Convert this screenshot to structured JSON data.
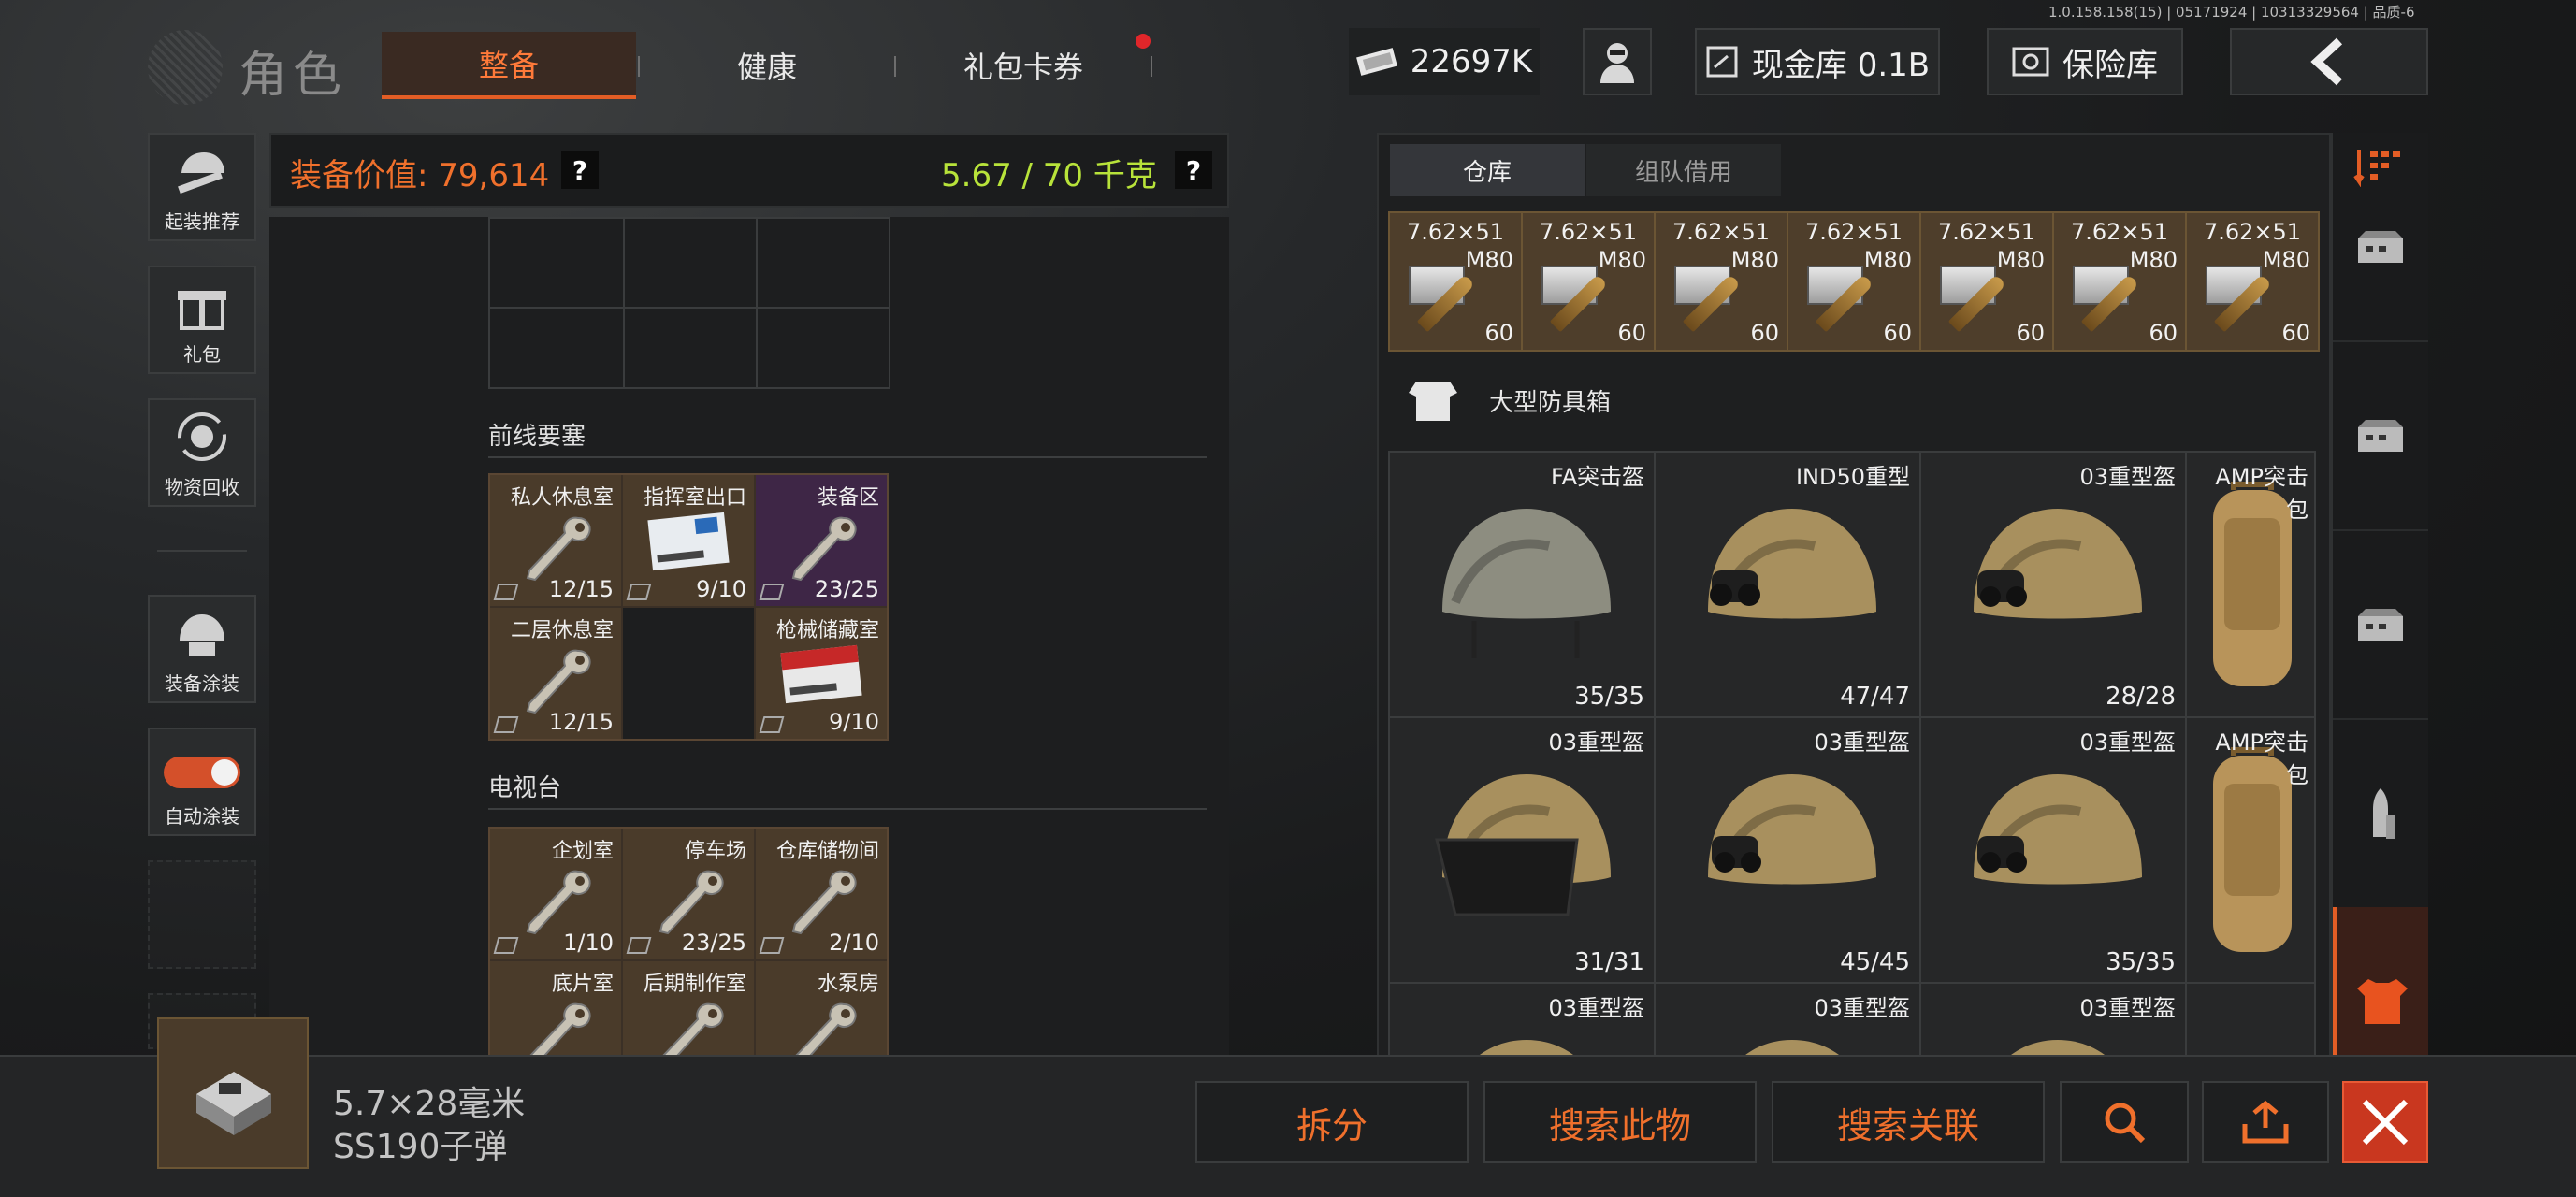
{
  "version": "1.0.158.158(15) | 05171924 | 10313329564 | 品质-6",
  "header": {
    "title": "角色",
    "tabs": [
      {
        "label": "整备",
        "active": true
      },
      {
        "label": "健康",
        "active": false
      },
      {
        "label": "礼包卡券",
        "active": false
      }
    ],
    "currency": "22697K",
    "cash_vault": "现金库 0.1B",
    "insurance": "保险库"
  },
  "sidebar": {
    "items": [
      {
        "label": "起装推荐"
      },
      {
        "label": "礼包"
      },
      {
        "label": "物资回收"
      },
      {
        "label": "装备涂装"
      },
      {
        "label": "自动涂装"
      }
    ]
  },
  "equipment": {
    "value_label": "装备价值: 79,614",
    "weight_label": "5.67 / 70 千克",
    "help": "?",
    "sections": [
      {
        "title": "前线要塞",
        "keys": [
          {
            "name": "私人休息室",
            "count": "12/15",
            "style": "key"
          },
          {
            "name": "指挥室出口",
            "count": "9/10",
            "style": "card"
          },
          {
            "name": "装备区",
            "count": "23/25",
            "style": "purple"
          },
          {
            "name": "二层休息室",
            "count": "12/15",
            "style": "key"
          },
          {
            "name": "",
            "count": "",
            "style": "empty"
          },
          {
            "name": "枪械储藏室",
            "count": "9/10",
            "style": "card"
          }
        ]
      },
      {
        "title": "电视台",
        "keys": [
          {
            "name": "企划室",
            "count": "1/10",
            "style": "key"
          },
          {
            "name": "停车场",
            "count": "23/25",
            "style": "key"
          },
          {
            "name": "仓库储物间",
            "count": "2/10",
            "style": "key"
          },
          {
            "name": "底片室",
            "count": "",
            "style": "key"
          },
          {
            "name": "后期制作室",
            "count": "",
            "style": "key"
          },
          {
            "name": "水泵房",
            "count": "",
            "style": "key"
          }
        ]
      }
    ]
  },
  "warehouse": {
    "tabs": [
      {
        "label": "仓库",
        "active": true
      },
      {
        "label": "组队借用",
        "active": false
      }
    ],
    "ammo": [
      {
        "name": "7.62×51",
        "sub": "M80",
        "count": "60"
      },
      {
        "name": "7.62×51",
        "sub": "M80",
        "count": "60"
      },
      {
        "name": "7.62×51",
        "sub": "M80",
        "count": "60"
      },
      {
        "name": "7.62×51",
        "sub": "M80",
        "count": "60"
      },
      {
        "name": "7.62×51",
        "sub": "M80",
        "count": "60"
      },
      {
        "name": "7.62×51",
        "sub": "M80",
        "count": "60"
      },
      {
        "name": "7.62×51",
        "sub": "M80",
        "count": "60"
      }
    ],
    "container_title": "大型防具箱",
    "items": [
      {
        "name": "FA突击盔",
        "count": "35/35",
        "kind": "helmet-plain"
      },
      {
        "name": "IND50重型",
        "count": "47/47",
        "kind": "helmet-nv"
      },
      {
        "name": "03重型盔",
        "count": "28/28",
        "kind": "helmet-camo"
      },
      {
        "name": "AMP突击\n包",
        "count": "",
        "kind": "backpack"
      },
      {
        "name": "03重型盔",
        "count": "31/31",
        "kind": "helmet-visor"
      },
      {
        "name": "03重型盔",
        "count": "45/45",
        "kind": "helmet-camo"
      },
      {
        "name": "03重型盔",
        "count": "35/35",
        "kind": "helmet-camo"
      },
      {
        "name": "AMP突击\n包",
        "count": "",
        "kind": "backpack"
      },
      {
        "name": "03重型盔",
        "count": "",
        "kind": "helmet-camo"
      },
      {
        "name": "03重型盔",
        "count": "",
        "kind": "helmet-camo"
      },
      {
        "name": "03重型盔",
        "count": "",
        "kind": "helmet-camo"
      },
      {
        "name": "",
        "count": "",
        "kind": "empty"
      }
    ]
  },
  "selected": {
    "line1": "5.7×28毫米",
    "line2": "SS190子弹"
  },
  "actions": {
    "split": "拆分",
    "search_item": "搜索此物",
    "search_related": "搜索关联"
  },
  "colors": {
    "accent": "#e35d25",
    "value": "#f0702c",
    "weight": "#b8e33a",
    "alert": "#e0262a"
  }
}
